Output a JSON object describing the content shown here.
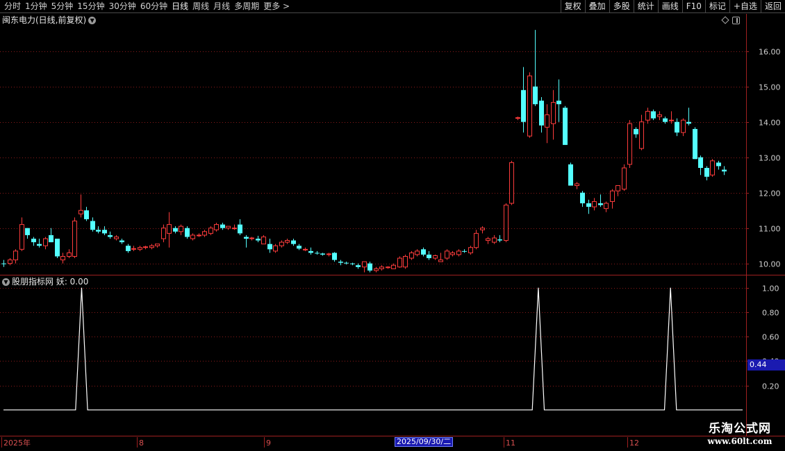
{
  "toolbar": {
    "periods": [
      {
        "label": "分时"
      },
      {
        "label": "1分钟"
      },
      {
        "label": "5分钟"
      },
      {
        "label": "15分钟"
      },
      {
        "label": "30分钟"
      },
      {
        "label": "60分钟"
      },
      {
        "label": "日线",
        "active": true
      },
      {
        "label": "周线"
      },
      {
        "label": "月线"
      },
      {
        "label": "多周期"
      },
      {
        "label": "更多 >"
      }
    ],
    "actions": [
      {
        "label": "复权"
      },
      {
        "label": "叠加"
      },
      {
        "label": "多股"
      },
      {
        "label": "统计"
      },
      {
        "label": "画线"
      },
      {
        "label": "F10"
      },
      {
        "label": "标记"
      },
      {
        "label": "+自选"
      },
      {
        "label": "返回"
      }
    ]
  },
  "price_panel": {
    "title": "闽东电力(日线,前复权)"
  },
  "indicator_panel": {
    "title": "股朋指标网 妖: 0.00",
    "highlight_value": "0.44"
  },
  "date_axis": {
    "labels": [
      "2025年",
      "8",
      "9",
      "11",
      "12"
    ],
    "cursor_date": "2025/09/30/二"
  },
  "watermark": {
    "title": "乐淘公式网",
    "url": "www.60lt.com"
  },
  "colors": {
    "up": "#ff3c3c",
    "down": "#54ffff",
    "grid": "#8b1a1a",
    "axis_line": "#a02020",
    "indicator_line": "#ffffff",
    "highlight": "#1a1ab0"
  },
  "chart_data": [
    {
      "type": "candlestick",
      "y_axis_ticks": [
        10.0,
        11.0,
        12.0,
        13.0,
        14.0,
        15.0,
        16.0
      ],
      "ylim": [
        9.7,
        16.7
      ],
      "ohlc": [
        [
          10.0,
          10.1,
          9.9,
          9.98
        ],
        [
          10.0,
          10.15,
          9.95,
          10.1
        ],
        [
          10.1,
          10.4,
          10.0,
          10.35
        ],
        [
          10.4,
          11.3,
          10.35,
          11.1
        ],
        [
          11.0,
          11.0,
          10.7,
          10.8
        ],
        [
          10.7,
          10.75,
          10.5,
          10.6
        ],
        [
          10.55,
          10.7,
          10.45,
          10.5
        ],
        [
          10.5,
          10.75,
          10.4,
          10.7
        ],
        [
          10.8,
          11.0,
          10.6,
          10.6
        ],
        [
          10.7,
          10.7,
          10.15,
          10.2
        ],
        [
          10.1,
          10.3,
          10.0,
          10.2
        ],
        [
          10.2,
          10.4,
          10.15,
          10.3
        ],
        [
          10.2,
          11.3,
          10.15,
          11.2
        ],
        [
          11.4,
          11.95,
          11.3,
          11.5
        ],
        [
          11.5,
          11.6,
          11.2,
          11.25
        ],
        [
          11.2,
          11.3,
          10.9,
          10.95
        ],
        [
          10.95,
          11.05,
          10.85,
          10.9
        ],
        [
          10.95,
          11.05,
          10.8,
          10.85
        ],
        [
          10.8,
          10.9,
          10.7,
          10.75
        ],
        [
          10.7,
          10.8,
          10.65,
          10.75
        ],
        [
          10.65,
          10.7,
          10.55,
          10.6
        ],
        [
          10.5,
          10.55,
          10.3,
          10.35
        ],
        [
          10.4,
          10.5,
          10.35,
          10.42
        ],
        [
          10.4,
          10.5,
          10.35,
          10.45
        ],
        [
          10.45,
          10.5,
          10.4,
          10.47
        ],
        [
          10.45,
          10.55,
          10.4,
          10.5
        ],
        [
          10.5,
          10.55,
          10.45,
          10.55
        ],
        [
          10.7,
          11.1,
          10.6,
          11.0
        ],
        [
          10.85,
          11.45,
          10.45,
          11.1
        ],
        [
          11.0,
          11.05,
          10.85,
          10.9
        ],
        [
          10.9,
          11.1,
          10.8,
          11.05
        ],
        [
          11.0,
          11.05,
          10.7,
          10.75
        ],
        [
          10.7,
          10.85,
          10.65,
          10.8
        ],
        [
          10.8,
          10.85,
          10.75,
          10.8
        ],
        [
          10.8,
          10.95,
          10.75,
          10.9
        ],
        [
          10.85,
          11.05,
          10.8,
          11.0
        ],
        [
          10.95,
          11.15,
          10.9,
          11.1
        ],
        [
          11.1,
          11.15,
          10.95,
          11.0
        ],
        [
          11.0,
          11.05,
          10.95,
          11.05
        ],
        [
          11.0,
          11.1,
          10.95,
          11.0
        ],
        [
          11.1,
          11.25,
          10.8,
          10.85
        ],
        [
          10.75,
          10.8,
          10.45,
          10.7
        ],
        [
          10.7,
          10.75,
          10.65,
          10.72
        ],
        [
          10.7,
          10.78,
          10.6,
          10.65
        ],
        [
          10.55,
          10.8,
          10.55,
          10.75
        ],
        [
          10.55,
          10.7,
          10.3,
          10.4
        ],
        [
          10.35,
          10.55,
          10.3,
          10.5
        ],
        [
          10.5,
          10.65,
          10.45,
          10.6
        ],
        [
          10.6,
          10.7,
          10.55,
          10.65
        ],
        [
          10.65,
          10.7,
          10.5,
          10.55
        ],
        [
          10.5,
          10.55,
          10.38,
          10.42
        ],
        [
          10.4,
          10.45,
          10.35,
          10.4
        ],
        [
          10.35,
          10.45,
          10.25,
          10.3
        ],
        [
          10.3,
          10.35,
          10.25,
          10.28
        ],
        [
          10.28,
          10.3,
          10.22,
          10.25
        ],
        [
          10.25,
          10.3,
          10.2,
          10.27
        ],
        [
          10.3,
          10.32,
          10.05,
          10.1
        ],
        [
          10.05,
          10.1,
          9.95,
          10.02
        ],
        [
          10.02,
          10.05,
          9.97,
          10.0
        ],
        [
          10.0,
          10.02,
          9.95,
          9.98
        ],
        [
          9.95,
          10.0,
          9.85,
          9.9
        ],
        [
          9.9,
          10.05,
          9.75,
          10.05
        ],
        [
          10.0,
          10.05,
          9.75,
          9.8
        ],
        [
          9.8,
          9.9,
          9.75,
          9.85
        ],
        [
          9.85,
          9.95,
          9.8,
          9.9
        ],
        [
          9.88,
          9.92,
          9.85,
          9.9
        ],
        [
          9.85,
          10.0,
          9.85,
          9.95
        ],
        [
          9.9,
          10.2,
          9.88,
          10.15
        ],
        [
          9.9,
          10.25,
          9.85,
          10.2
        ],
        [
          10.15,
          10.35,
          10.1,
          10.3
        ],
        [
          10.25,
          10.4,
          10.2,
          10.35
        ],
        [
          10.4,
          10.45,
          10.2,
          10.25
        ],
        [
          10.25,
          10.35,
          10.1,
          10.15
        ],
        [
          10.15,
          10.25,
          10.1,
          10.22
        ],
        [
          10.05,
          10.3,
          10.05,
          10.1
        ],
        [
          10.15,
          10.4,
          10.1,
          10.35
        ],
        [
          10.25,
          10.35,
          10.2,
          10.3
        ],
        [
          10.25,
          10.4,
          10.2,
          10.35
        ],
        [
          10.35,
          10.4,
          10.3,
          10.33
        ],
        [
          10.3,
          10.5,
          10.25,
          10.45
        ],
        [
          10.45,
          10.95,
          10.4,
          10.85
        ],
        [
          10.95,
          11.05,
          10.85,
          11.0
        ],
        [
          10.65,
          10.75,
          10.55,
          10.7
        ],
        [
          10.6,
          10.8,
          10.55,
          10.72
        ],
        [
          10.68,
          10.8,
          10.6,
          10.65
        ],
        [
          10.65,
          11.7,
          10.6,
          11.65
        ],
        [
          11.7,
          12.9,
          11.65,
          12.85
        ],
        [
          14.1,
          14.15,
          14.05,
          14.12
        ],
        [
          14.9,
          15.55,
          13.7,
          14.0
        ],
        [
          13.6,
          15.4,
          13.55,
          15.3
        ],
        [
          15.0,
          16.6,
          14.45,
          14.5
        ],
        [
          14.6,
          14.7,
          13.7,
          13.9
        ],
        [
          13.85,
          14.5,
          13.4,
          14.2
        ],
        [
          13.95,
          14.9,
          13.5,
          14.55
        ],
        [
          14.6,
          15.2,
          14.0,
          14.5
        ],
        [
          14.4,
          14.45,
          13.35,
          13.35
        ],
        [
          12.8,
          12.85,
          12.2,
          12.2
        ],
        [
          12.2,
          12.3,
          12.1,
          12.25
        ],
        [
          12.0,
          12.05,
          11.6,
          11.7
        ],
        [
          11.7,
          11.8,
          11.4,
          11.6
        ],
        [
          11.6,
          11.85,
          11.5,
          11.75
        ],
        [
          11.7,
          11.95,
          11.6,
          11.65
        ],
        [
          11.55,
          11.75,
          11.45,
          11.7
        ],
        [
          11.75,
          12.1,
          11.55,
          12.05
        ],
        [
          12.05,
          12.2,
          11.9,
          12.2
        ],
        [
          12.1,
          12.8,
          12.05,
          12.7
        ],
        [
          12.8,
          14.05,
          12.7,
          13.95
        ],
        [
          13.8,
          13.85,
          13.55,
          13.65
        ],
        [
          13.25,
          14.2,
          13.2,
          14.0
        ],
        [
          14.05,
          14.4,
          13.95,
          14.3
        ],
        [
          14.3,
          14.35,
          14.05,
          14.1
        ],
        [
          14.15,
          14.3,
          14.05,
          14.2
        ],
        [
          14.1,
          14.15,
          13.95,
          14.0
        ],
        [
          14.05,
          14.3,
          13.95,
          14.05
        ],
        [
          14.0,
          14.1,
          13.6,
          13.7
        ],
        [
          13.7,
          14.1,
          13.6,
          14.05
        ],
        [
          14.0,
          14.4,
          13.9,
          13.95
        ],
        [
          13.8,
          13.85,
          12.95,
          12.95
        ],
        [
          13.0,
          13.05,
          12.5,
          12.7
        ],
        [
          12.7,
          12.75,
          12.35,
          12.45
        ],
        [
          12.5,
          12.95,
          12.45,
          12.9
        ],
        [
          12.85,
          12.9,
          12.65,
          12.75
        ],
        [
          12.65,
          12.75,
          12.5,
          12.6
        ]
      ]
    },
    {
      "type": "line",
      "name": "妖",
      "y_axis_ticks": [
        0.2,
        0.4,
        0.6,
        0.8,
        1.0
      ],
      "ylim": [
        -0.2,
        1.1
      ],
      "x_count": 124,
      "spike_indices": [
        13,
        89,
        111
      ],
      "spike_value": 1.0,
      "base_value": 0.0,
      "last_value": 0.0
    }
  ]
}
